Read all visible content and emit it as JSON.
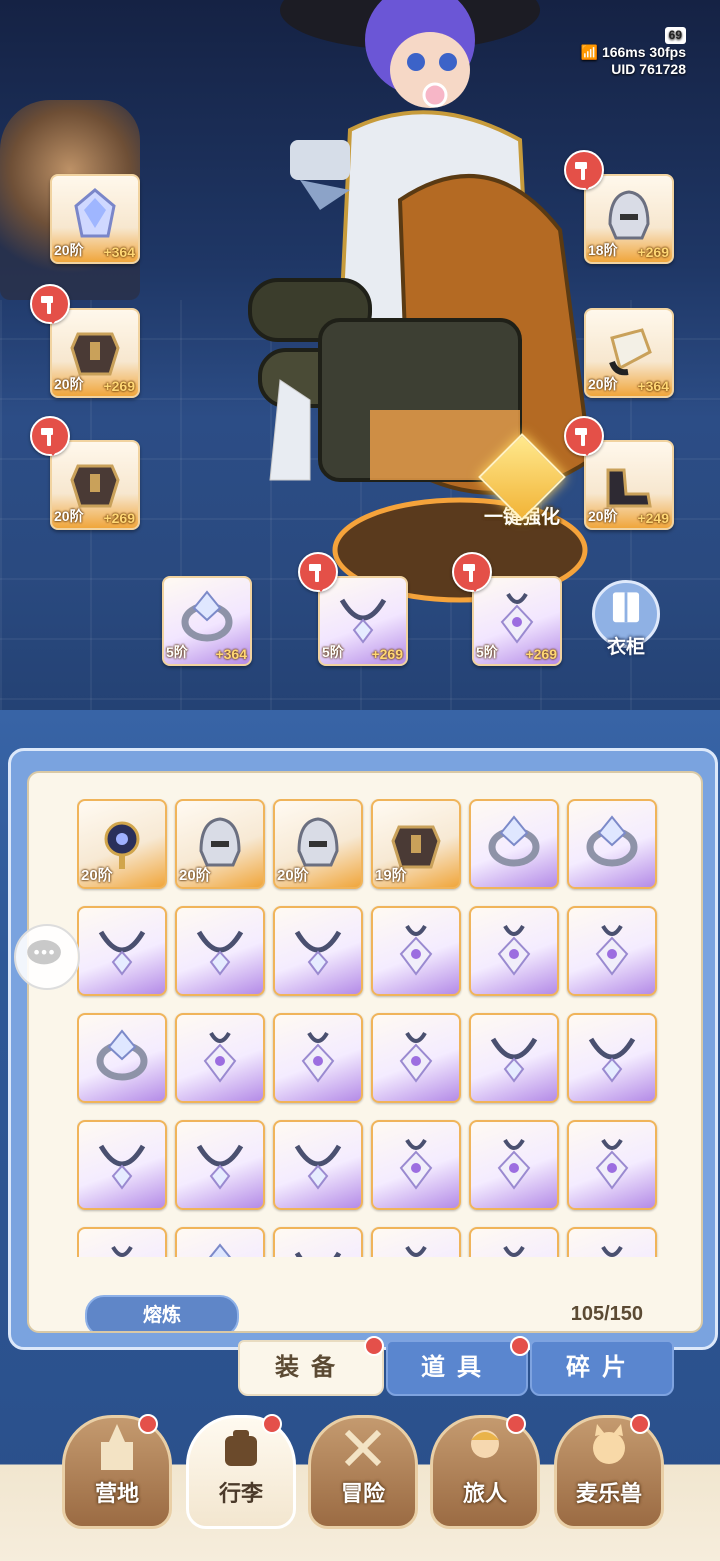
{
  "status": {
    "battery": "69",
    "ping": "166ms",
    "fps": "30fps",
    "uid_label": "UID",
    "uid": "761728"
  },
  "equipped": {
    "left": [
      {
        "level": "20阶",
        "bonus": "+364",
        "icon": "crystal-crown-icon",
        "hammer": false
      },
      {
        "level": "20阶",
        "bonus": "+269",
        "icon": "armor-chest-icon",
        "hammer": true
      },
      {
        "level": "20阶",
        "bonus": "+269",
        "icon": "armor-chest-icon",
        "hammer": true
      }
    ],
    "right": [
      {
        "level": "18阶",
        "bonus": "+269",
        "icon": "helmet-icon",
        "hammer": true
      },
      {
        "level": "20阶",
        "bonus": "+364",
        "icon": "gauntlet-icon",
        "hammer": false
      },
      {
        "level": "20阶",
        "bonus": "+249",
        "icon": "boots-icon",
        "hammer": true
      }
    ],
    "accessories": [
      {
        "level": "5阶",
        "bonus": "+364",
        "icon": "ring-icon",
        "hammer": false
      },
      {
        "level": "5阶",
        "bonus": "+269",
        "icon": "necklace-icon",
        "hammer": true
      },
      {
        "level": "5阶",
        "bonus": "+269",
        "icon": "amulet-icon",
        "hammer": true
      }
    ]
  },
  "one_key_enhance": "一键强化",
  "wardrobe": "衣柜",
  "inventory": {
    "rows": [
      [
        {
          "icon": "orb-staff-icon",
          "level": "20阶",
          "color": "orange"
        },
        {
          "icon": "helmet-icon",
          "level": "20阶",
          "color": "orange"
        },
        {
          "icon": "helmet-icon",
          "level": "20阶",
          "color": "orange"
        },
        {
          "icon": "armor-chest-icon",
          "level": "19阶",
          "color": "orange"
        },
        {
          "icon": "ring-icon",
          "level": "",
          "color": "purple"
        },
        {
          "icon": "ring-icon",
          "level": "",
          "color": "purple"
        }
      ],
      [
        {
          "icon": "necklace-icon",
          "level": "",
          "color": "purple"
        },
        {
          "icon": "necklace-icon",
          "level": "",
          "color": "purple"
        },
        {
          "icon": "necklace-icon",
          "level": "",
          "color": "purple"
        },
        {
          "icon": "amulet-icon",
          "level": "",
          "color": "purple"
        },
        {
          "icon": "amulet-icon",
          "level": "",
          "color": "purple"
        },
        {
          "icon": "amulet-icon",
          "level": "",
          "color": "purple"
        }
      ],
      [
        {
          "icon": "ring-icon",
          "level": "",
          "color": "purple"
        },
        {
          "icon": "amulet-icon",
          "level": "",
          "color": "purple"
        },
        {
          "icon": "amulet-icon",
          "level": "",
          "color": "purple"
        },
        {
          "icon": "amulet-icon",
          "level": "",
          "color": "purple"
        },
        {
          "icon": "necklace-icon",
          "level": "",
          "color": "purple"
        },
        {
          "icon": "necklace-icon",
          "level": "",
          "color": "purple"
        }
      ],
      [
        {
          "icon": "necklace-icon",
          "level": "",
          "color": "purple"
        },
        {
          "icon": "necklace-icon",
          "level": "",
          "color": "purple"
        },
        {
          "icon": "necklace-icon",
          "level": "",
          "color": "purple"
        },
        {
          "icon": "amulet-icon",
          "level": "",
          "color": "purple"
        },
        {
          "icon": "amulet-icon",
          "level": "",
          "color": "purple"
        },
        {
          "icon": "amulet-icon",
          "level": "",
          "color": "purple"
        }
      ],
      [
        {
          "icon": "amulet-icon",
          "level": "",
          "color": "purple"
        },
        {
          "icon": "ring-icon",
          "level": "",
          "color": "purple"
        },
        {
          "icon": "necklace-icon",
          "level": "",
          "color": "purple"
        },
        {
          "icon": "amulet-icon",
          "level": "",
          "color": "purple"
        },
        {
          "icon": "amulet-icon",
          "level": "",
          "color": "purple"
        },
        {
          "icon": "amulet-icon",
          "level": "",
          "color": "purple"
        }
      ]
    ],
    "smelt_button": "熔炼",
    "capacity": "105/150"
  },
  "tabs": [
    {
      "label": "装备",
      "active": true,
      "badge": true
    },
    {
      "label": "道具",
      "active": false,
      "badge": true
    },
    {
      "label": "碎片",
      "active": false,
      "badge": false
    }
  ],
  "nav": [
    {
      "label": "营地",
      "icon": "castle-icon",
      "active": false,
      "badge": true
    },
    {
      "label": "行李",
      "icon": "backpack-icon",
      "active": true,
      "badge": true
    },
    {
      "label": "冒险",
      "icon": "crossed-swords-icon",
      "active": false,
      "badge": false
    },
    {
      "label": "旅人",
      "icon": "traveler-portrait-icon",
      "active": false,
      "badge": true
    },
    {
      "label": "麦乐兽",
      "icon": "pet-cat-icon",
      "active": false,
      "badge": true
    }
  ],
  "colors": {
    "accent_orange": "#f0a63c",
    "accent_purple": "#b48be7",
    "badge_red": "#e4504a",
    "panel_blue": "#7aa3df"
  }
}
